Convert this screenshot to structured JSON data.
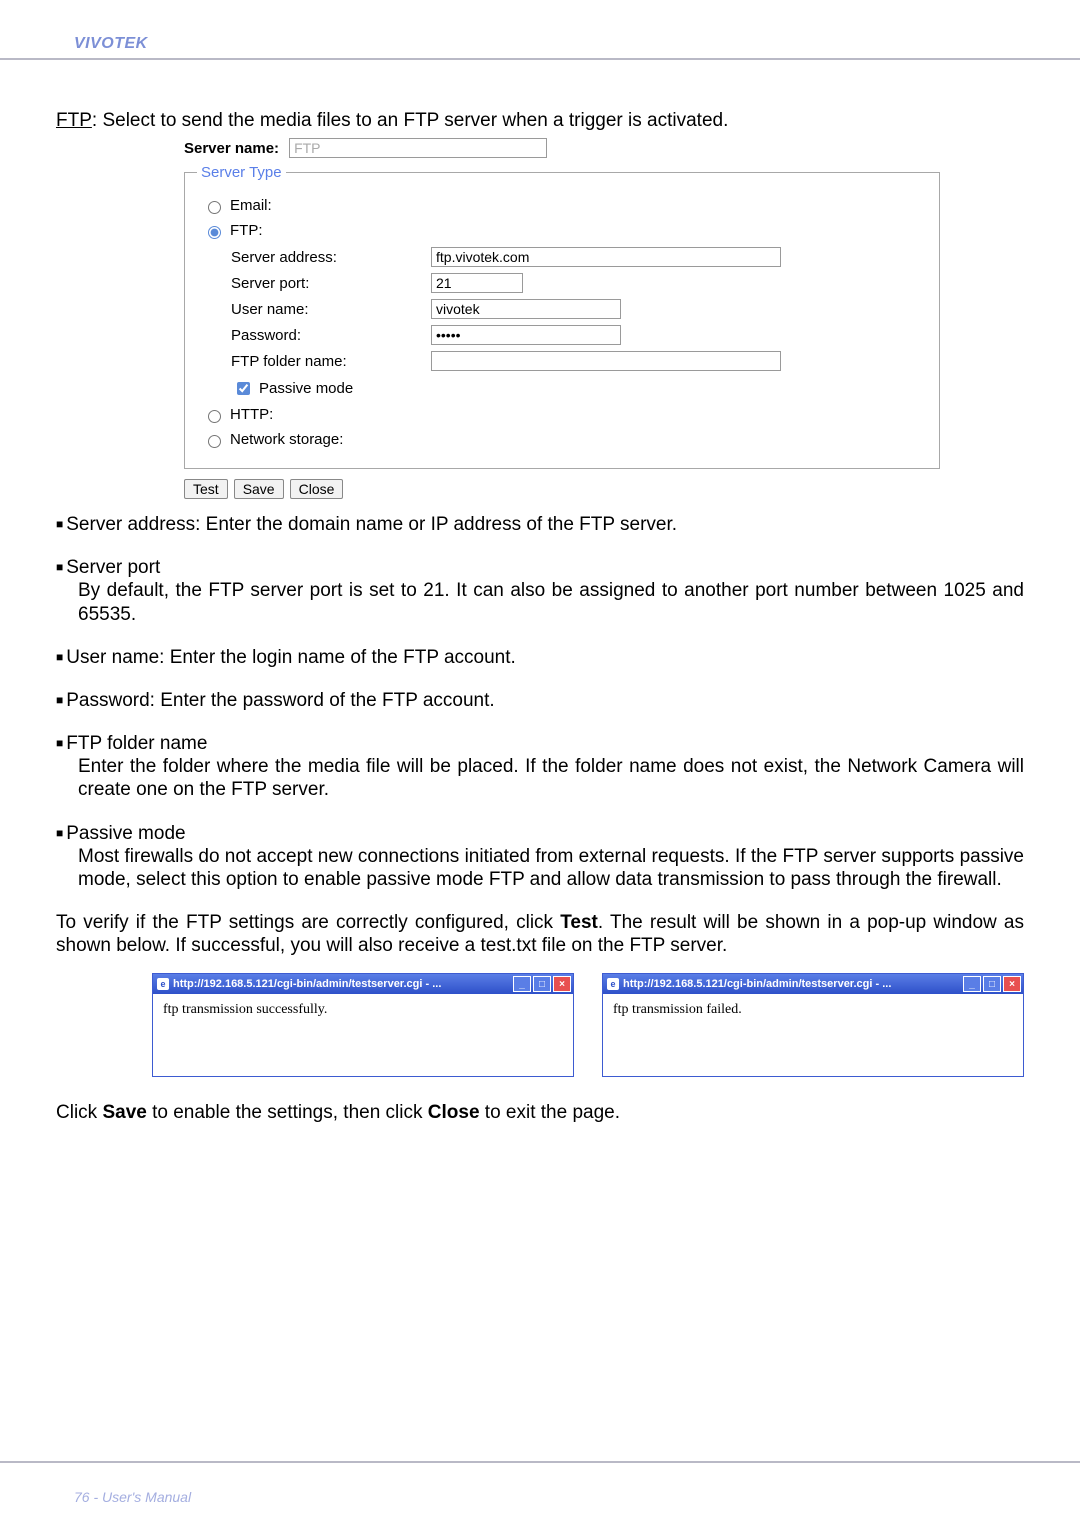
{
  "header": {
    "brand": "VIVOTEK"
  },
  "intro": {
    "ftp_label": "FTP",
    "tail": ": Select to send the media files to an FTP server when a trigger is activated."
  },
  "form": {
    "server_name_label": "Server name:",
    "server_name_value": "FTP",
    "fieldset_legend": "Server Type",
    "radios": {
      "email": "Email:",
      "ftp": "FTP:",
      "http": "HTTP:",
      "netstorage": "Network storage:"
    },
    "ftp": {
      "server_address_label": "Server address:",
      "server_address_value": "ftp.vivotek.com",
      "server_port_label": "Server port:",
      "server_port_value": "21",
      "user_name_label": "User name:",
      "user_name_value": "vivotek",
      "password_label": "Password:",
      "password_value": "•••••",
      "folder_label": "FTP folder name:",
      "folder_value": "",
      "passive_label": "Passive mode"
    },
    "buttons": {
      "test": "Test",
      "save": "Save",
      "close": "Close"
    }
  },
  "bullets": {
    "server_address": "Server address: Enter the domain name or IP address of the FTP server.",
    "server_port_head": "Server port",
    "server_port_body": "By default, the FTP server port is set to 21. It can also be assigned to another port number between 1025 and 65535.",
    "user_name": "User name: Enter the login name of the FTP account.",
    "password": "Password: Enter the password of the FTP account.",
    "folder_head": "FTP folder name",
    "folder_body": "Enter the folder where the media file will be placed. If the folder name does not exist, the Network Camera will create one on the FTP server.",
    "passive_head": "Passive mode",
    "passive_body": "Most firewalls do not accept new connections initiated from external requests. If the FTP server supports passive mode, select this option to enable passive mode FTP and allow data transmission to pass through the firewall."
  },
  "verify": {
    "pre": "To verify if the FTP settings are correctly configured, click ",
    "test": "Test",
    "mid": ". The result will be shown in a pop-up window as shown below. If successful, you will also receive a test.txt file on the FTP server."
  },
  "popups": {
    "title": "http://192.168.5.121/cgi-bin/admin/testserver.cgi - ...",
    "success": "ftp transmission successfully.",
    "fail": "ftp transmission failed."
  },
  "closing": {
    "pre": "Click ",
    "save": "Save",
    "mid": " to enable the settings, then click ",
    "close": "Close",
    "tail": " to exit the page."
  },
  "footer": {
    "page": "76",
    "title": "User's Manual"
  }
}
